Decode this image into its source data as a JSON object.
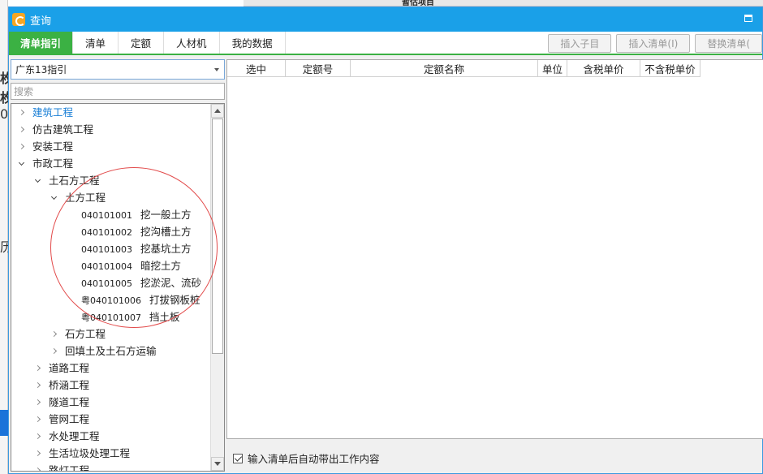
{
  "background": {
    "top_text": "暂估项目",
    "left_glyphs": [
      "枚",
      "枚",
      "0",
      "历"
    ]
  },
  "window": {
    "title": "查询"
  },
  "tabs": [
    {
      "label": "清单指引",
      "active": true
    },
    {
      "label": "清单",
      "active": false
    },
    {
      "label": "定额",
      "active": false
    },
    {
      "label": "人材机",
      "active": false
    },
    {
      "label": "我的数据",
      "active": false
    }
  ],
  "toolbar": {
    "insert_child": "插入子目",
    "insert_list": "插入清单(I)",
    "replace_list": "替换清单("
  },
  "left": {
    "combo_value": "广东13指引",
    "search_placeholder": "搜索"
  },
  "tree": [
    {
      "label": "建筑工程",
      "level": 0,
      "state": "collapsed",
      "selected": true
    },
    {
      "label": "仿古建筑工程",
      "level": 0,
      "state": "collapsed"
    },
    {
      "label": "安装工程",
      "level": 0,
      "state": "collapsed"
    },
    {
      "label": "市政工程",
      "level": 0,
      "state": "expanded"
    },
    {
      "label": "土石方工程",
      "level": 1,
      "state": "expanded"
    },
    {
      "label": "土方工程",
      "level": 2,
      "state": "expanded"
    },
    {
      "code": "040101001",
      "label": "挖一般土方",
      "level": 3,
      "state": "leaf"
    },
    {
      "code": "040101002",
      "label": "挖沟槽土方",
      "level": 3,
      "state": "leaf"
    },
    {
      "code": "040101003",
      "label": "挖基坑土方",
      "level": 3,
      "state": "leaf"
    },
    {
      "code": "040101004",
      "label": "暗挖土方",
      "level": 3,
      "state": "leaf"
    },
    {
      "code": "040101005",
      "label": "挖淤泥、流砂",
      "level": 3,
      "state": "leaf"
    },
    {
      "code": "粤040101006",
      "label": "打拔钢板桩",
      "level": 3,
      "state": "leaf"
    },
    {
      "code": "粤040101007",
      "label": "挡土板",
      "level": 3,
      "state": "leaf"
    },
    {
      "label": "石方工程",
      "level": 2,
      "state": "collapsed"
    },
    {
      "label": "回填土及土石方运输",
      "level": 2,
      "state": "collapsed"
    },
    {
      "label": "道路工程",
      "level": 1,
      "state": "collapsed"
    },
    {
      "label": "桥涵工程",
      "level": 1,
      "state": "collapsed"
    },
    {
      "label": "隧道工程",
      "level": 1,
      "state": "collapsed"
    },
    {
      "label": "管网工程",
      "level": 1,
      "state": "collapsed"
    },
    {
      "label": "水处理工程",
      "level": 1,
      "state": "collapsed"
    },
    {
      "label": "生活垃圾处理工程",
      "level": 1,
      "state": "collapsed"
    },
    {
      "label": "路灯工程",
      "level": 1,
      "state": "collapsed"
    }
  ],
  "grid": {
    "columns": [
      "选中",
      "定额号",
      "定额名称",
      "单位",
      "含税单价",
      "不含税单价"
    ]
  },
  "footer": {
    "checkbox_label": "输入清单后自动带出工作内容",
    "checked": true
  },
  "colors": {
    "titlebar": "#1aa0e8",
    "tab_active": "#3bb143",
    "selected_node": "#1a7fd6",
    "annotation_circle": "#e24b4b"
  }
}
